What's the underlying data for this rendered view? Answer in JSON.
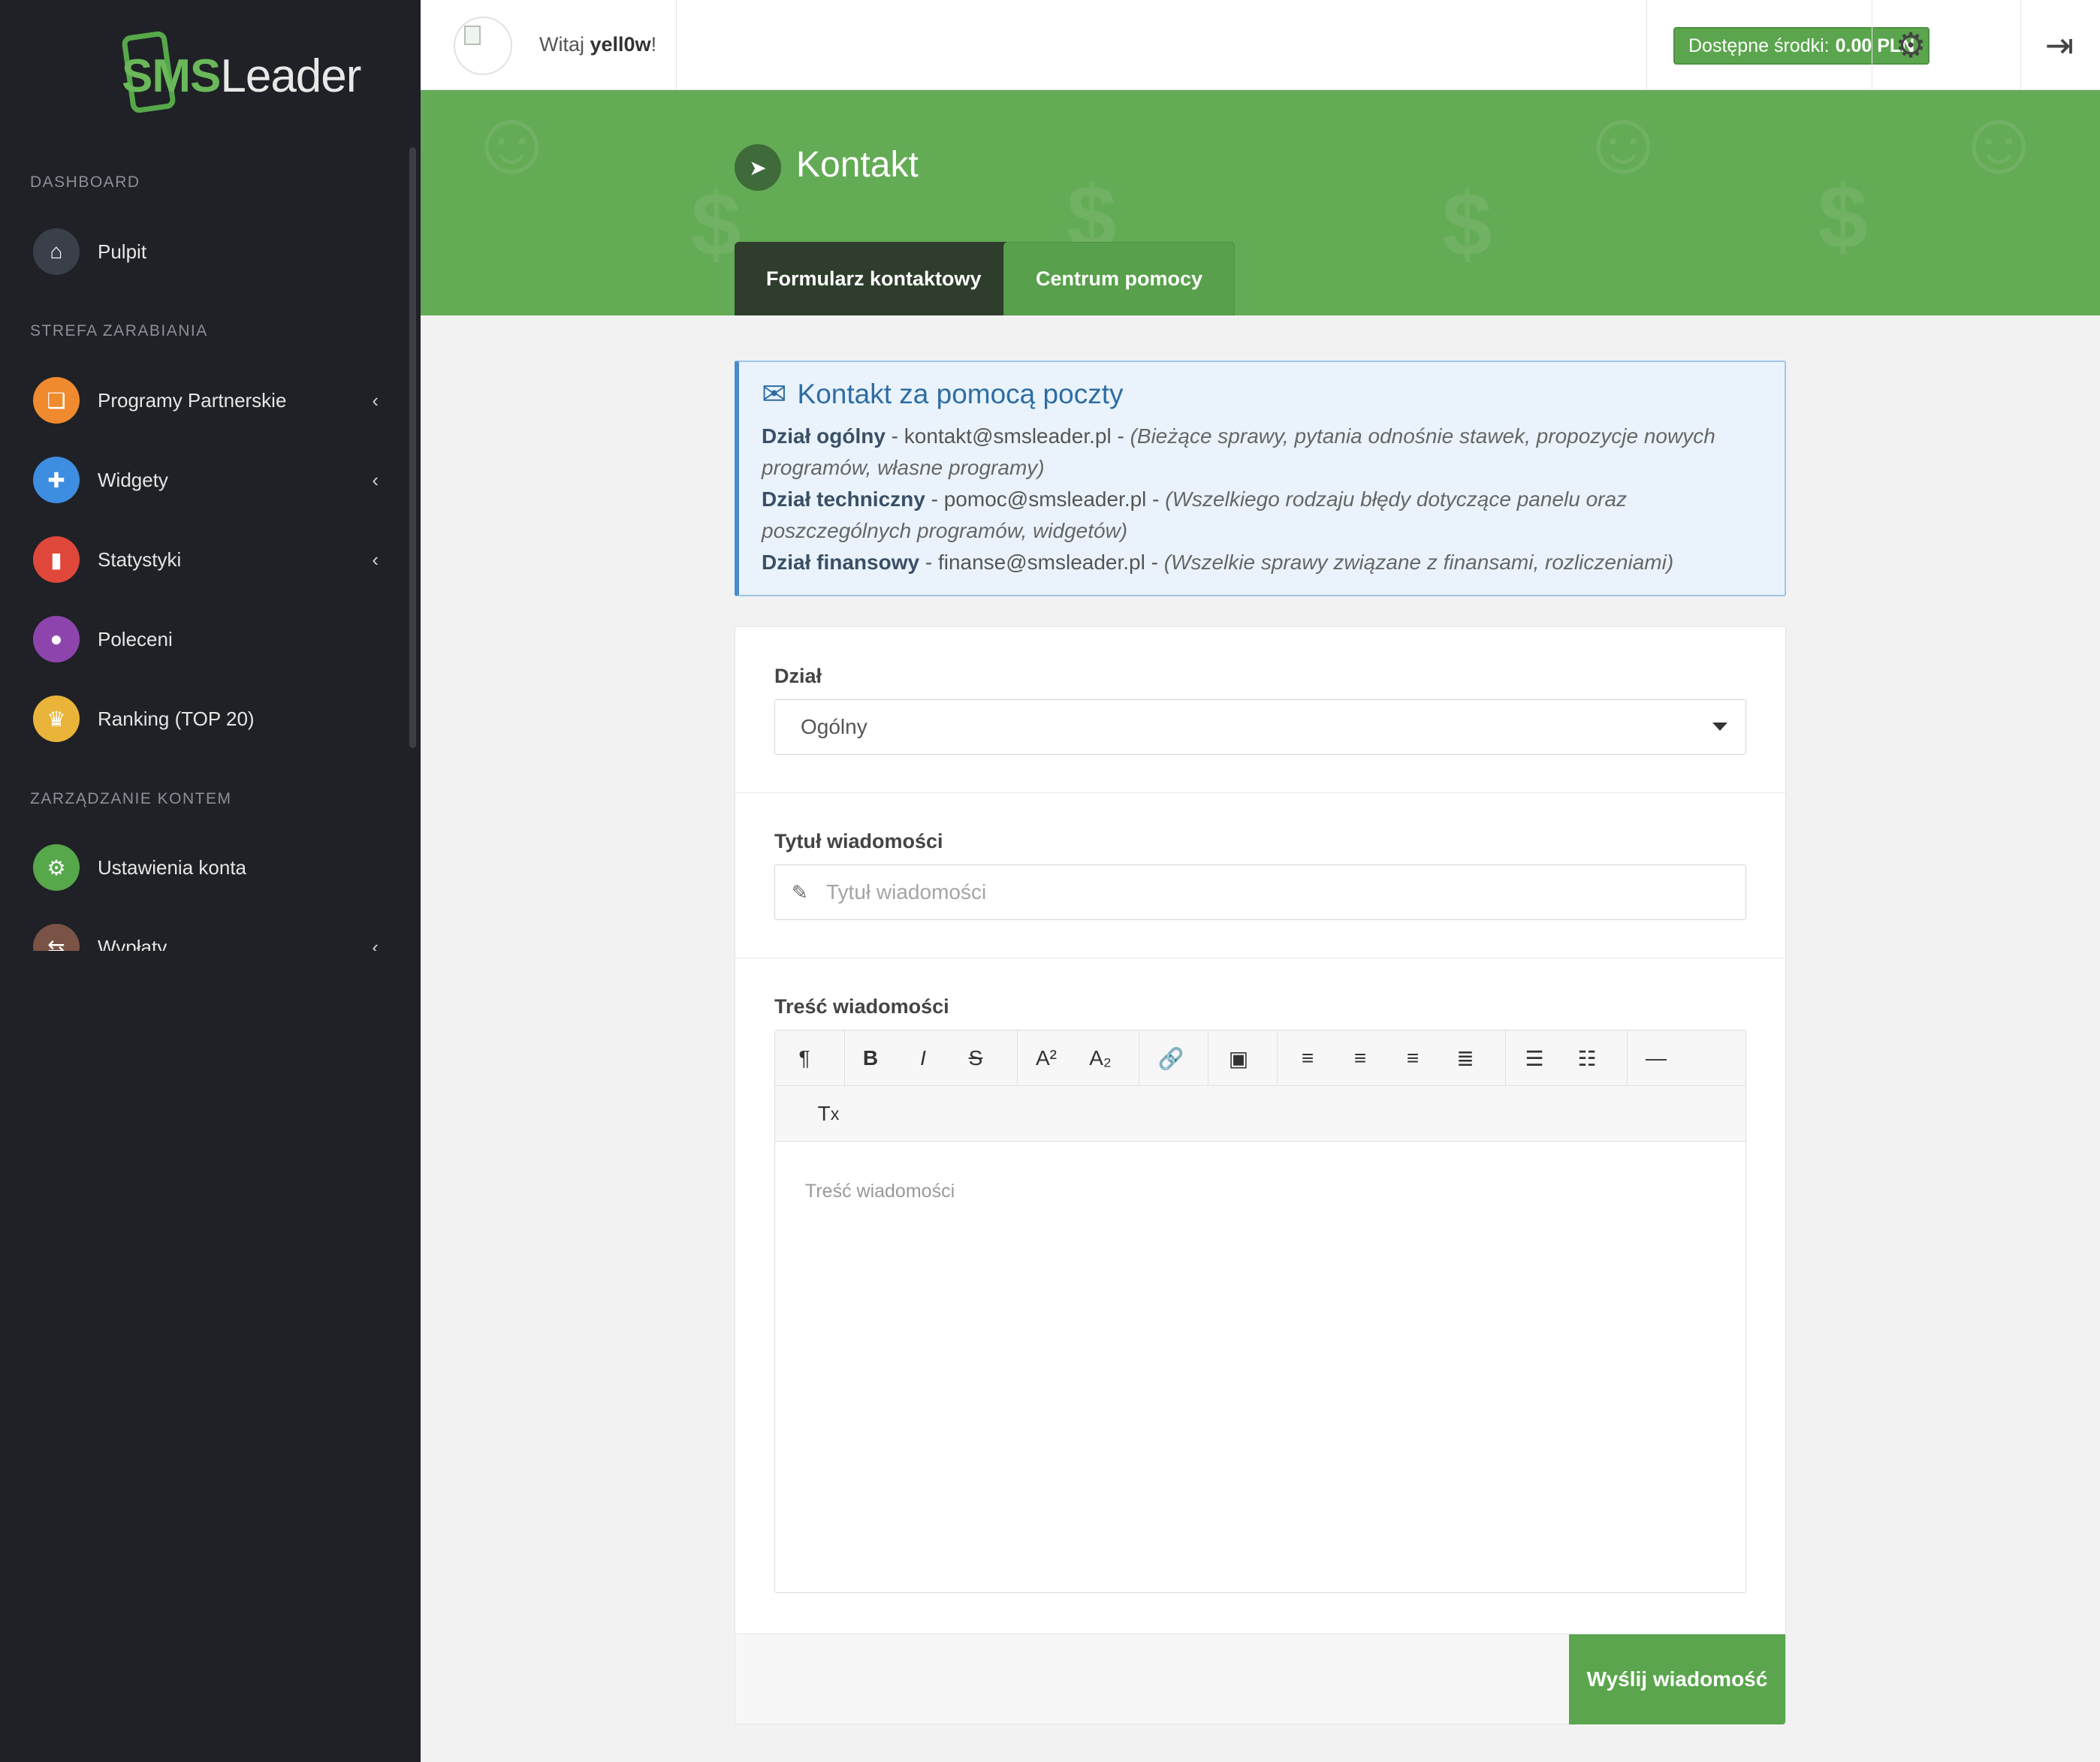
{
  "brand": {
    "sms": "SMS",
    "leader": "Leader"
  },
  "sidebar": {
    "sections": {
      "dashboard": "DASHBOARD",
      "earn": "STREFA ZARABIANIA",
      "account": "ZARZĄDZANIE KONTEM"
    },
    "items": [
      {
        "label": "Pulpit",
        "color": "#3a3f49",
        "icon": "home-icon"
      },
      {
        "label": "Programy Partnerskie",
        "color": "#f08a2e",
        "icon": "gift-icon"
      },
      {
        "label": "Widgety",
        "color": "#3d8de0",
        "icon": "puzzle-icon"
      },
      {
        "label": "Statystyki",
        "color": "#e0473b",
        "icon": "bar-chart-icon"
      },
      {
        "label": "Poleceni",
        "color": "#8e44ad",
        "icon": "users-icon"
      },
      {
        "label": "Ranking (TOP 20)",
        "color": "#eab43a",
        "icon": "trophy-icon"
      },
      {
        "label": "Ustawienia konta",
        "color": "#56a84a",
        "icon": "gear-icon"
      },
      {
        "label": "Wypłaty",
        "color": "#7a5346",
        "icon": "exchange-icon"
      }
    ]
  },
  "topbar": {
    "greeting_prefix": "Witaj",
    "username": "yell0w",
    "greeting_suffix": "!",
    "funds_label": "Dostępne środki:",
    "funds_value": "0.00 PLN"
  },
  "page": {
    "title": "Kontakt",
    "tabs": [
      "Formularz kontaktowy",
      "Centrum pomocy"
    ]
  },
  "info": {
    "title": "Kontakt za pomocą poczty",
    "lines": [
      {
        "dept": "Dział ogólny",
        "sep1": " - ",
        "email": "kontakt@smsleader.pl",
        "sep2": " - ",
        "desc": "(Bieżące sprawy, pytania odnośnie stawek, propozycje nowych programów, własne programy)"
      },
      {
        "dept": "Dział techniczny",
        "sep1": " - ",
        "email": "pomoc@smsleader.pl",
        "sep2": " - ",
        "desc": "(Wszelkiego rodzaju błędy dotyczące panelu oraz poszczególnych programów, widgetów)"
      },
      {
        "dept": "Dział finansowy",
        "sep1": " - ",
        "email": "finanse@smsleader.pl",
        "sep2": " - ",
        "desc": "(Wszelkie sprawy związane z finansami, rozliczeniami)"
      }
    ]
  },
  "form": {
    "dept_label": "Dział",
    "dept_value": "Ogólny",
    "title_label": "Tytuł wiadomości",
    "title_placeholder": "Tytuł wiadomości",
    "body_label": "Treść wiadomości",
    "body_placeholder": "Treść wiadomości",
    "submit": "Wyślij wiadomość"
  },
  "colors": {
    "accent": "#5aa54d",
    "sidebar": "#1f2126",
    "band": "#64ab56"
  }
}
